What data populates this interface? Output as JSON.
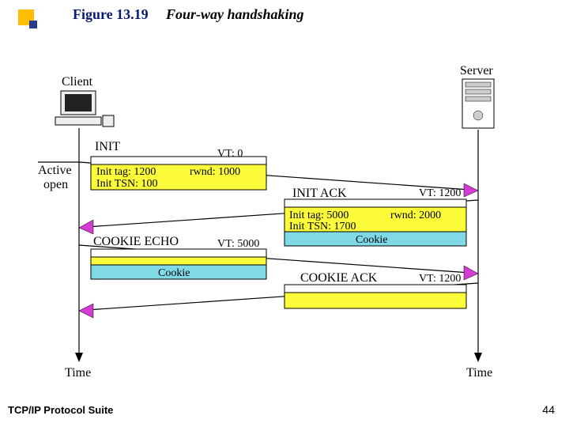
{
  "figure_number": "Figure 13.19",
  "figure_title": "Four-way handshaking",
  "footer": "TCP/IP Protocol Suite",
  "page": "44",
  "client": "Client",
  "server": "Server",
  "active_open": "Active\nopen",
  "time": "Time",
  "m1": {
    "name": "INIT",
    "vt": "VT: 0",
    "init_tag": "Init tag: 1200",
    "rwnd": "rwnd: 1000",
    "init_tsn": "Init TSN: 100"
  },
  "m2": {
    "name": "INIT ACK",
    "vt": "VT: 1200",
    "init_tag": "Init tag: 5000",
    "rwnd": "rwnd: 2000",
    "init_tsn": "Init TSN: 1700",
    "cookie": "Cookie"
  },
  "m3": {
    "name": "COOKIE ECHO",
    "vt": "VT: 5000",
    "cookie": "Cookie"
  },
  "m4": {
    "name": "COOKIE ACK",
    "vt": "VT: 1200"
  }
}
